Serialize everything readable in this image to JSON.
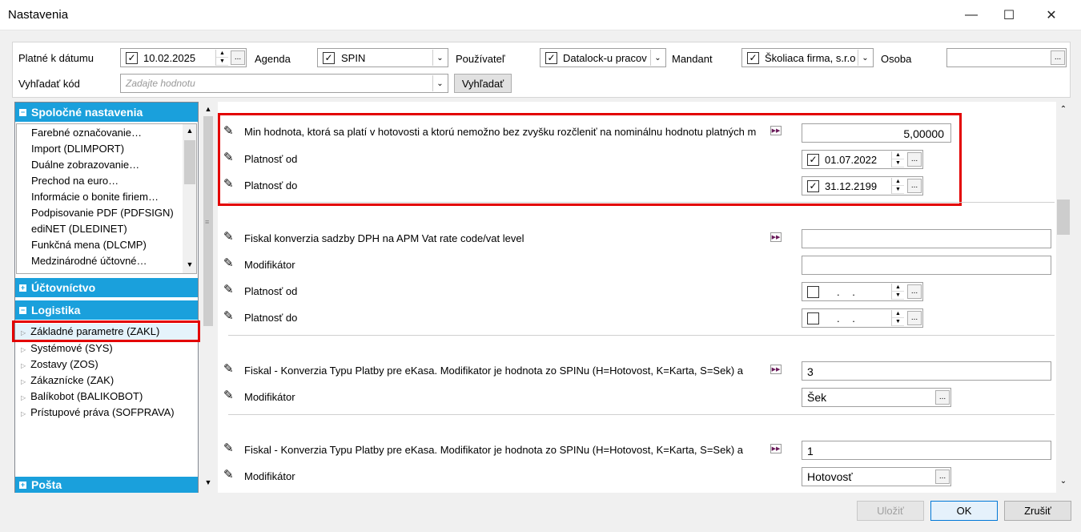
{
  "window": {
    "title": "Nastavenia",
    "minimize": "—",
    "maximize": "☐",
    "close": "✕"
  },
  "filters": {
    "platne_label": "Platné k dátumu",
    "platne_value": "10.02.2025",
    "agenda_label": "Agenda",
    "agenda_value": "SPIN",
    "pouzivatel_label": "Používateľ",
    "pouzivatel_value": "Datalock-u pracov",
    "mandant_label": "Mandant",
    "mandant_value": "Školiaca firma, s.r.o",
    "osoba_label": "Osoba",
    "osoba_value": "",
    "kod_label": "Vyhľadať kód",
    "kod_placeholder": "Zadajte hodnotu",
    "search_button": "Vyhľadať",
    "ellipsis": "...",
    "check": "✓"
  },
  "tree": {
    "spolocne": "Spoločné nastavenia",
    "spolocne_items": [
      "Farebné označovanie…",
      "Import (DLIMPORT)",
      "Duálne zobrazovanie…",
      "Prechod na euro…",
      "Informácie o bonite firiem…",
      "Podpisovanie PDF (PDFSIGN)",
      "ediNET (DLEDINET)",
      "Funkčná mena (DLCMP)",
      "Medzinárodné účtovné…"
    ],
    "uctovnictvo": "Účtovníctvo",
    "logistika": "Logistika",
    "logistika_items": [
      "Základné parametre (ZAKL)",
      "Systémové (SYS)",
      "Zostavy (ZOS)",
      "Zákaznícke (ZAK)",
      "Balíkobot (BALIKOBOT)",
      "Prístupové práva (SOFPRAVA)"
    ],
    "posta": "Pošta"
  },
  "settings": {
    "g1_label": "Min hodnota, ktorá sa platí v hotovosti a ktorú nemožno bez zvyšku rozčleniť na nominálnu hodnotu platných m",
    "g1_value": "5,00000",
    "platnost_od": "Platnosť od",
    "platnost_do": "Platnosť do",
    "g1_od": "01.07.2022",
    "g1_do": "31.12.2199",
    "g2_label": "Fiskal konverzia sadzby DPH na APM Vat rate code/vat level",
    "modifikator": "Modifikátor",
    "empty_date": ". .",
    "g3_label": "Fiskal - Konverzia Typu Platby pre eKasa. Modifikator je hodnota zo SPINu (H=Hotovost, K=Karta, S=Sek)  a",
    "g3_value": "3",
    "g3_mod": "Šek",
    "g4_label": "Fiskal - Konverzia Typu Platby pre eKasa. Modifikator je hodnota zo SPINu (H=Hotovost, K=Karta, S=Sek)  a",
    "g4_value": "1",
    "g4_mod": "Hotovosť"
  },
  "footer": {
    "apply": "Uložiť",
    "ok": "OK",
    "cancel": "Zrušiť"
  }
}
